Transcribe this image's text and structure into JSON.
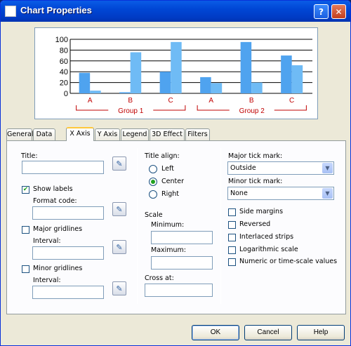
{
  "window": {
    "title": "Chart Properties",
    "help_glyph": "?",
    "close_glyph": "✕"
  },
  "preview_chart": {
    "type": "bar",
    "y_ticks": [
      "100",
      "80",
      "60",
      "40",
      "20",
      "0"
    ],
    "ylim": [
      0,
      100
    ],
    "categories": [
      "A",
      "B",
      "C",
      "A",
      "B",
      "C"
    ],
    "groups": [
      "Group 1",
      "Group 2"
    ],
    "series": [
      {
        "values": [
          38,
          2,
          40,
          30,
          95,
          70
        ]
      },
      {
        "values": [
          5,
          76,
          95,
          19,
          20,
          52
        ]
      }
    ],
    "colors": [
      "#4fa3ef",
      "#6fbbf5"
    ]
  },
  "tabs": [
    "General",
    "Data",
    "X Axis",
    "Y Axis",
    "Legend",
    "3D Effect",
    "Filters"
  ],
  "active_tab": "X Axis",
  "left": {
    "title_label": "Title:",
    "title_value": "",
    "show_labels": "Show labels",
    "show_labels_checked": true,
    "format_code": "Format code:",
    "major_gridlines": "Major gridlines",
    "major_interval": "Interval:",
    "minor_gridlines": "Minor gridlines",
    "minor_interval": "Interval:"
  },
  "middle": {
    "title_align": "Title align:",
    "align_options": [
      "Left",
      "Center",
      "Right"
    ],
    "align_selected": "Center",
    "scale": "Scale",
    "minimum": "Minimum:",
    "maximum": "Maximum:",
    "cross_at": "Cross at:"
  },
  "right": {
    "major_tick_label": "Major tick mark:",
    "major_tick_value": "Outside",
    "minor_tick_label": "Minor tick mark:",
    "minor_tick_value": "None",
    "options": [
      "Side margins",
      "Reversed",
      "Interlaced strips",
      "Logarithmic scale",
      "Numeric or time-scale values"
    ]
  },
  "buttons": {
    "ok": "OK",
    "cancel": "Cancel",
    "help": "Help"
  }
}
